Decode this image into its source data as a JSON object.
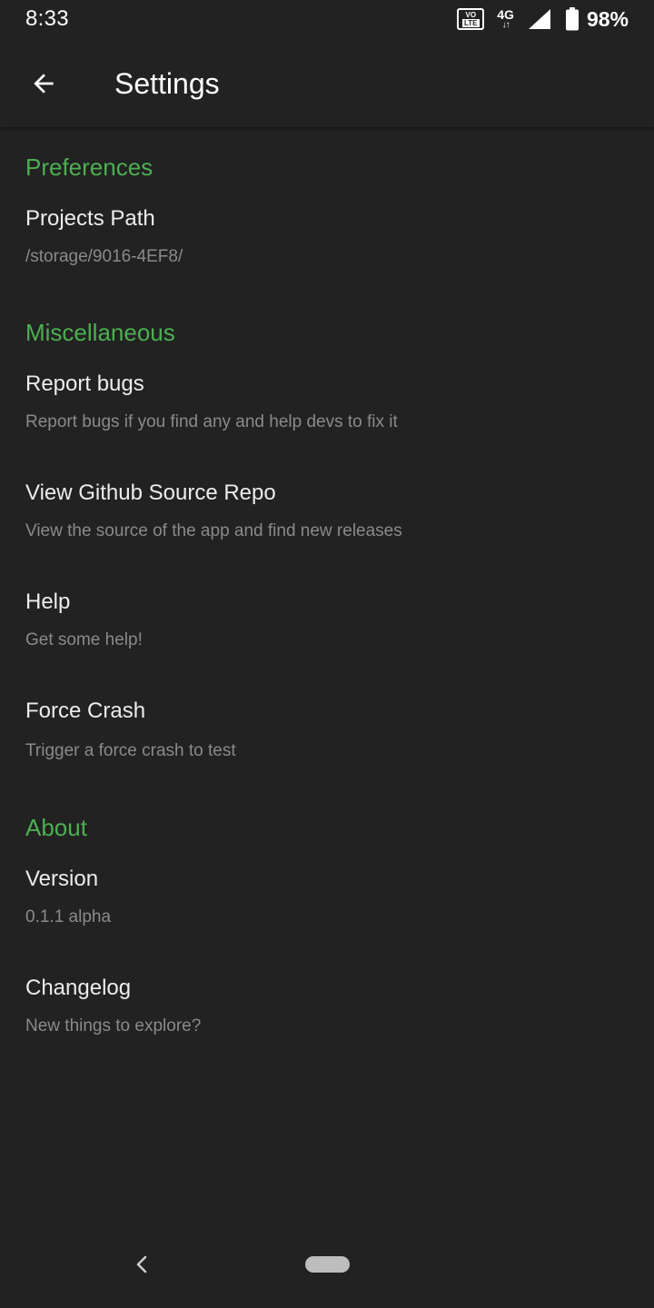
{
  "status_bar": {
    "time": "8:33",
    "volte_top": "VO",
    "volte_bottom": "LTE",
    "network": "4G",
    "network_arrows": "↓↑",
    "battery_percent": "98%"
  },
  "app_bar": {
    "title": "Settings"
  },
  "sections": {
    "preferences": {
      "header": "Preferences",
      "projects_path": {
        "title": "Projects Path",
        "summary": "/storage/9016-4EF8/"
      }
    },
    "miscellaneous": {
      "header": "Miscellaneous",
      "report_bugs": {
        "title": "Report bugs",
        "summary": "Report bugs if you find any and help devs to fix it"
      },
      "github": {
        "title": "View Github Source Repo",
        "summary": "View the source of the app and find new releases"
      },
      "help": {
        "title": "Help",
        "summary": "Get some help!"
      },
      "force_crash": {
        "title": "Force Crash",
        "summary": "Trigger a force crash to test"
      }
    },
    "about": {
      "header": "About",
      "version": {
        "title": "Version",
        "summary": "0.1.1 alpha"
      },
      "changelog": {
        "title": "Changelog",
        "summary": "New things to explore?"
      }
    }
  },
  "colors": {
    "background": "#222222",
    "accent": "#4caf50",
    "title_text": "#ececec",
    "summary_text": "#8a8a8a"
  }
}
